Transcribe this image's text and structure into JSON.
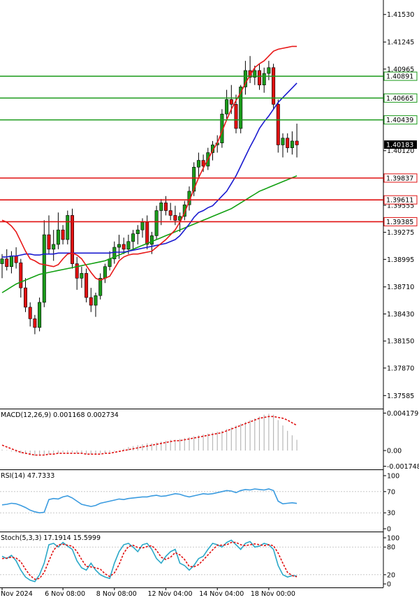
{
  "chart_data": {
    "type": "candlestick",
    "main": {
      "y_ticks": [
        1.4153,
        1.41245,
        1.40965,
        1.4012,
        1.39555,
        1.39275,
        1.38995,
        1.3871,
        1.3843,
        1.3815,
        1.3787,
        1.37585
      ],
      "ylim": [
        1.3745,
        1.4168
      ],
      "level_lines": [
        {
          "value": 1.40891,
          "color": "#1a9a1a",
          "label": "1.40891"
        },
        {
          "value": 1.40665,
          "color": "#1a9a1a",
          "label": "1.40665"
        },
        {
          "value": 1.40439,
          "color": "#1a9a1a",
          "label": "1.40439"
        },
        {
          "value": 1.39837,
          "color": "#e01010",
          "label": "1.39837"
        },
        {
          "value": 1.39611,
          "color": "#e01010",
          "label": "1.39611"
        },
        {
          "value": 1.39385,
          "color": "#e01010",
          "label": "1.39385"
        }
      ],
      "last_price": {
        "value": 1.40183,
        "label": "1.40183"
      },
      "candles": [
        [
          1.3895,
          1.3905,
          1.388,
          1.39
        ],
        [
          1.39,
          1.391,
          1.3888,
          1.3892
        ],
        [
          1.3892,
          1.3908,
          1.3885,
          1.3903
        ],
        [
          1.3903,
          1.3912,
          1.389,
          1.3896
        ],
        [
          1.3896,
          1.39,
          1.386,
          1.387
        ],
        [
          1.387,
          1.388,
          1.3845,
          1.385
        ],
        [
          1.385,
          1.3855,
          1.383,
          1.3838
        ],
        [
          1.3838,
          1.3842,
          1.3822,
          1.3829
        ],
        [
          1.3829,
          1.386,
          1.3825,
          1.3855
        ],
        [
          1.3855,
          1.394,
          1.385,
          1.3925
        ],
        [
          1.3925,
          1.3945,
          1.3905,
          1.391
        ],
        [
          1.391,
          1.393,
          1.3898,
          1.3915
        ],
        [
          1.3915,
          1.3948,
          1.391,
          1.393
        ],
        [
          1.393,
          1.3935,
          1.3915,
          1.392
        ],
        [
          1.392,
          1.395,
          1.3915,
          1.3945
        ],
        [
          1.3945,
          1.3952,
          1.389,
          1.3895
        ],
        [
          1.3895,
          1.3902,
          1.3868,
          1.388
        ],
        [
          1.388,
          1.3892,
          1.387,
          1.3885
        ],
        [
          1.3885,
          1.389,
          1.3855,
          1.386
        ],
        [
          1.386,
          1.387,
          1.3845,
          1.3852
        ],
        [
          1.3852,
          1.3865,
          1.384,
          1.3862
        ],
        [
          1.3862,
          1.3885,
          1.3858,
          1.388
        ],
        [
          1.388,
          1.3895,
          1.3875,
          1.3892
        ],
        [
          1.3892,
          1.3908,
          1.3888,
          1.39
        ],
        [
          1.39,
          1.3918,
          1.3895,
          1.3912
        ],
        [
          1.3912,
          1.3925,
          1.39,
          1.3915
        ],
        [
          1.3915,
          1.3922,
          1.3905,
          1.391
        ],
        [
          1.391,
          1.3925,
          1.3905,
          1.3918
        ],
        [
          1.3918,
          1.393,
          1.391,
          1.3926
        ],
        [
          1.3926,
          1.3935,
          1.3915,
          1.393
        ],
        [
          1.393,
          1.3942,
          1.3922,
          1.3938
        ],
        [
          1.3938,
          1.3945,
          1.391,
          1.3915
        ],
        [
          1.3915,
          1.3928,
          1.3905,
          1.3924
        ],
        [
          1.3924,
          1.3955,
          1.392,
          1.395
        ],
        [
          1.395,
          1.3962,
          1.3935,
          1.3958
        ],
        [
          1.3958,
          1.3965,
          1.3945,
          1.395
        ],
        [
          1.395,
          1.3958,
          1.394,
          1.3945
        ],
        [
          1.3945,
          1.3955,
          1.3935,
          1.394
        ],
        [
          1.394,
          1.3948,
          1.3928,
          1.3944
        ],
        [
          1.3944,
          1.396,
          1.394,
          1.3956
        ],
        [
          1.3956,
          1.3975,
          1.395,
          1.397
        ],
        [
          1.397,
          1.4,
          1.3965,
          1.3995
        ],
        [
          1.3995,
          1.401,
          1.3985,
          1.4002
        ],
        [
          1.4002,
          1.4008,
          1.399,
          1.3996
        ],
        [
          1.3996,
          1.4015,
          1.3992,
          1.401
        ],
        [
          1.401,
          1.4022,
          1.4002,
          1.4018
        ],
        [
          1.4018,
          1.4028,
          1.401,
          1.402
        ],
        [
          1.402,
          1.4055,
          1.4015,
          1.405
        ],
        [
          1.405,
          1.4075,
          1.4045,
          1.4065
        ],
        [
          1.4065,
          1.408,
          1.405,
          1.406
        ],
        [
          1.406,
          1.407,
          1.403,
          1.4035
        ],
        [
          1.4035,
          1.408,
          1.403,
          1.4078
        ],
        [
          1.4078,
          1.4105,
          1.407,
          1.4095
        ],
        [
          1.4095,
          1.411,
          1.4082,
          1.4088
        ],
        [
          1.4088,
          1.41,
          1.408,
          1.4095
        ],
        [
          1.4095,
          1.4102,
          1.4075,
          1.408
        ],
        [
          1.408,
          1.4098,
          1.4072,
          1.4092
        ],
        [
          1.4092,
          1.4105,
          1.4085,
          1.4098
        ],
        [
          1.4098,
          1.4102,
          1.4055,
          1.406
        ],
        [
          1.406,
          1.4065,
          1.401,
          1.4018
        ],
        [
          1.4018,
          1.403,
          1.4005,
          1.4025
        ],
        [
          1.4025,
          1.403,
          1.401,
          1.4015
        ],
        [
          1.4015,
          1.4032,
          1.4008,
          1.4022
        ],
        [
          1.4022,
          1.404,
          1.4005,
          1.4018
        ]
      ],
      "ma_fast": [
        1.394,
        1.3938,
        1.3934,
        1.3928,
        1.3918,
        1.3908,
        1.39,
        1.3898,
        1.3895,
        1.3894,
        1.3893,
        1.3892,
        1.3894,
        1.39,
        1.3905,
        1.3906,
        1.3904,
        1.39,
        1.3893,
        1.3886,
        1.388,
        1.3878,
        1.388,
        1.3882,
        1.389,
        1.3898,
        1.3902,
        1.3904,
        1.3905,
        1.3905,
        1.3906,
        1.3907,
        1.3908,
        1.3912,
        1.3916,
        1.392,
        1.3925,
        1.393,
        1.3938,
        1.3948,
        1.396,
        1.3972,
        1.3984,
        1.3994,
        1.4003,
        1.4012,
        1.402,
        1.4032,
        1.4044,
        1.4055,
        1.4064,
        1.4072,
        1.4082,
        1.409,
        1.4098,
        1.4102,
        1.4105,
        1.411,
        1.4115,
        1.4117,
        1.4118,
        1.4119,
        1.412,
        1.412
      ],
      "ma_mid": [
        1.3902,
        1.3902,
        1.3903,
        1.3903,
        1.3904,
        1.3905,
        1.3905,
        1.3904,
        1.3904,
        1.3905,
        1.3905,
        1.3905,
        1.3906,
        1.3906,
        1.3906,
        1.3906,
        1.3906,
        1.3906,
        1.3906,
        1.3906,
        1.3906,
        1.3906,
        1.3906,
        1.3906,
        1.3907,
        1.3907,
        1.3907,
        1.3908,
        1.3909,
        1.391,
        1.3911,
        1.3912,
        1.3913,
        1.3914,
        1.3915,
        1.3916,
        1.3918,
        1.392,
        1.3924,
        1.393,
        1.3936,
        1.3943,
        1.3948,
        1.395,
        1.3953,
        1.3955,
        1.396,
        1.3965,
        1.397,
        1.3978,
        1.3986,
        1.3996,
        1.4006,
        1.4016,
        1.4025,
        1.4035,
        1.4042,
        1.4048,
        1.4055,
        1.4062,
        1.4067,
        1.4072,
        1.4077,
        1.4082
      ],
      "ma_slow": [
        1.3865,
        1.3868,
        1.3871,
        1.3874,
        1.3876,
        1.3878,
        1.388,
        1.3882,
        1.3884,
        1.3885,
        1.3886,
        1.3887,
        1.3888,
        1.3889,
        1.389,
        1.3891,
        1.3892,
        1.3893,
        1.3894,
        1.3895,
        1.3896,
        1.3897,
        1.3898,
        1.39,
        1.3902,
        1.3904,
        1.3906,
        1.3908,
        1.391,
        1.3912,
        1.3914,
        1.3916,
        1.3918,
        1.392,
        1.3922,
        1.3924,
        1.3926,
        1.3928,
        1.393,
        1.3932,
        1.3934,
        1.3936,
        1.3938,
        1.394,
        1.3942,
        1.3944,
        1.3946,
        1.3948,
        1.395,
        1.3952,
        1.3955,
        1.3958,
        1.3961,
        1.3964,
        1.3967,
        1.397,
        1.3972,
        1.3974,
        1.3976,
        1.3978,
        1.398,
        1.3982,
        1.3984,
        1.3986
      ]
    },
    "macd": {
      "label": "MACD(12,26,9) 0.001168 0.002734",
      "y_ticks": [
        {
          "value": 0.004179,
          "label": "0.004179"
        },
        {
          "value": 0.0,
          "label": "0.00"
        },
        {
          "value": -0.001748,
          "label": "-0.001748"
        }
      ],
      "ylim": [
        -0.0021,
        0.0046
      ],
      "histogram": [
        0.0001,
        5e-05,
        -0.0001,
        -0.0002,
        -0.0003,
        -0.0004,
        -0.0005,
        -0.0006,
        -0.0006,
        -0.0005,
        -0.0004,
        -0.0003,
        -0.0003,
        -0.0002,
        -0.0002,
        -0.0002,
        -0.0003,
        -0.0003,
        -0.0004,
        -0.0004,
        -0.0004,
        -0.0003,
        -0.0003,
        -0.0002,
        -0.0001,
        0.0,
        0.0002,
        0.0004,
        0.0005,
        0.0006,
        0.0007,
        0.0008,
        0.0008,
        0.0009,
        0.001,
        0.0011,
        0.0012,
        0.0012,
        0.0013,
        0.0014,
        0.0015,
        0.0016,
        0.0017,
        0.0018,
        0.0019,
        0.002,
        0.0021,
        0.0022,
        0.0024,
        0.0026,
        0.0028,
        0.003,
        0.0032,
        0.0034,
        0.0036,
        0.0038,
        0.004,
        0.0041,
        0.004,
        0.0034,
        0.0028,
        0.0022,
        0.0017,
        0.0012
      ],
      "signal": [
        0.0006,
        0.0004,
        0.0002,
        0.0,
        -0.0002,
        -0.0003,
        -0.0004,
        -0.0005,
        -0.0005,
        -0.0005,
        -0.0004,
        -0.0004,
        -0.0003,
        -0.0003,
        -0.0003,
        -0.0003,
        -0.0003,
        -0.0003,
        -0.0004,
        -0.0004,
        -0.0004,
        -0.0004,
        -0.0003,
        -0.0003,
        -0.0002,
        -0.0001,
        0.0,
        0.0001,
        0.0002,
        0.0003,
        0.0004,
        0.0005,
        0.0006,
        0.0007,
        0.0008,
        0.0009,
        0.001,
        0.0011,
        0.0011,
        0.0012,
        0.0013,
        0.0014,
        0.0015,
        0.0016,
        0.0017,
        0.0018,
        0.0019,
        0.002,
        0.0022,
        0.0024,
        0.0026,
        0.0028,
        0.003,
        0.0032,
        0.0034,
        0.0036,
        0.0037,
        0.0038,
        0.0038,
        0.0037,
        0.0036,
        0.0034,
        0.0031,
        0.0028
      ]
    },
    "rsi": {
      "label": "RSI(14) 47.7333",
      "y_ticks": [
        100,
        70,
        30,
        0
      ],
      "ylim": [
        0,
        100
      ],
      "values": [
        45,
        46,
        48,
        47,
        44,
        40,
        35,
        32,
        30,
        31,
        55,
        57,
        56,
        60,
        62,
        58,
        52,
        46,
        44,
        42,
        44,
        48,
        50,
        52,
        54,
        56,
        55,
        57,
        58,
        59,
        60,
        60,
        62,
        63,
        61,
        62,
        64,
        66,
        65,
        62,
        60,
        62,
        64,
        66,
        65,
        66,
        68,
        70,
        72,
        71,
        68,
        72,
        74,
        73,
        75,
        74,
        73,
        75,
        72,
        52,
        47,
        48,
        49,
        47.7333
      ]
    },
    "stoch": {
      "label": "Stoch(5,3,3) 17.1914 15.5999",
      "y_ticks": [
        100,
        80,
        20,
        0
      ],
      "ylim": [
        0,
        100
      ],
      "k": [
        60,
        55,
        62,
        50,
        30,
        15,
        8,
        5,
        20,
        45,
        85,
        88,
        80,
        90,
        82,
        75,
        50,
        35,
        30,
        45,
        30,
        20,
        15,
        12,
        45,
        70,
        85,
        88,
        80,
        70,
        85,
        88,
        75,
        55,
        45,
        60,
        70,
        75,
        45,
        40,
        30,
        40,
        55,
        60,
        75,
        88,
        85,
        80,
        90,
        95,
        85,
        75,
        88,
        92,
        80,
        82,
        88,
        85,
        75,
        40,
        20,
        15,
        18,
        17.1914
      ],
      "d": [
        55,
        56,
        58,
        56,
        48,
        32,
        18,
        10,
        12,
        25,
        50,
        73,
        85,
        86,
        84,
        82,
        70,
        53,
        38,
        37,
        35,
        32,
        22,
        16,
        24,
        42,
        67,
        81,
        84,
        79,
        78,
        81,
        83,
        73,
        58,
        53,
        58,
        68,
        63,
        53,
        38,
        37,
        42,
        52,
        63,
        74,
        84,
        84,
        85,
        90,
        90,
        85,
        83,
        85,
        87,
        85,
        83,
        85,
        83,
        67,
        45,
        25,
        18,
        15.5999
      ]
    },
    "x_ticks": [
      {
        "index": 0,
        "label": "Nov 2024"
      },
      {
        "index": 13,
        "label": "6 Nov 08:00"
      },
      {
        "index": 24,
        "label": "8 Nov 08:00"
      },
      {
        "index": 35,
        "label": "12 Nov 04:00"
      },
      {
        "index": 46,
        "label": "14 Nov 04:00"
      },
      {
        "index": 57,
        "label": "18 Nov 00:00"
      }
    ]
  }
}
